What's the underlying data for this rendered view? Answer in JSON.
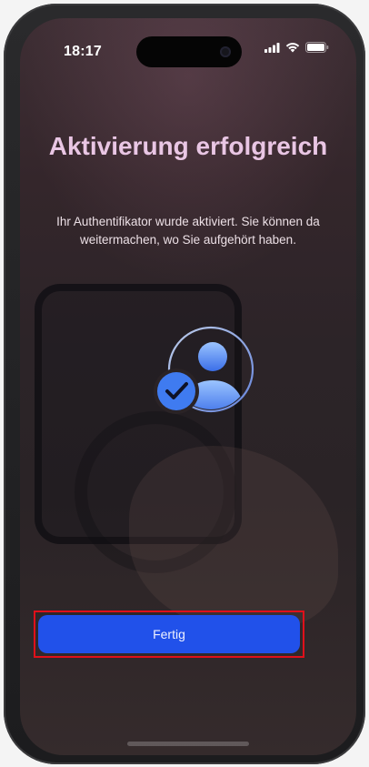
{
  "status_bar": {
    "time": "18:17",
    "icons": [
      "cellular-signal-icon",
      "wifi-icon",
      "battery-icon"
    ]
  },
  "screen": {
    "title": "Aktivierung erfolgreich",
    "message": "Ihr Authentifikator wurde aktiviert. Sie können da weitermachen, wo Sie aufgehört haben.",
    "illustration": "user-verified-icon"
  },
  "actions": {
    "done_label": "Fertig"
  },
  "colors": {
    "title": "#e9c6e4",
    "button": "#2151ea",
    "highlight": "#e0101a",
    "icon_blue": "#3f7bf0"
  }
}
